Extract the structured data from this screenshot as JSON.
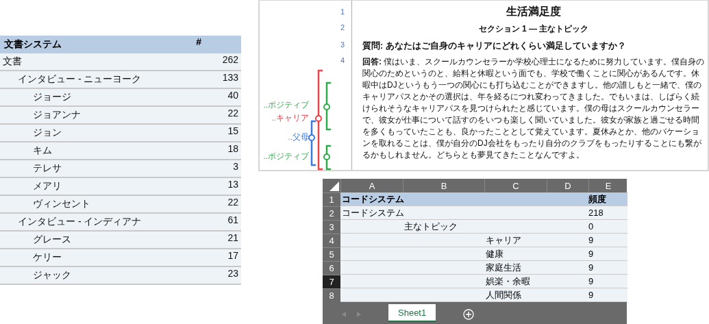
{
  "document_system": {
    "header": {
      "name": "文書システム",
      "count": "#"
    },
    "items": [
      {
        "name": "文書",
        "count": "262",
        "children": [
          {
            "name": "インタビュー - ニューヨーク",
            "count": "133",
            "children": [
              {
                "name": "ジョージ",
                "count": "40"
              },
              {
                "name": "ジョアンナ",
                "count": "22"
              },
              {
                "name": "ジョン",
                "count": "15"
              },
              {
                "name": "キム",
                "count": "18"
              },
              {
                "name": "テレサ",
                "count": "3"
              },
              {
                "name": "メアリ",
                "count": "13"
              },
              {
                "name": "ヴィンセント",
                "count": "22"
              }
            ]
          },
          {
            "name": "インタビュー - インディアナ",
            "count": "61",
            "children": [
              {
                "name": "グレース",
                "count": "21"
              },
              {
                "name": "ケリー",
                "count": "17"
              },
              {
                "name": "ジャック",
                "count": "23"
              }
            ]
          }
        ]
      }
    ]
  },
  "document_viewer": {
    "codes": [
      {
        "label": "..ポジティブ",
        "color": "#2eaa4a"
      },
      {
        "label": "..キャリア",
        "color": "#e8464b"
      },
      {
        "label": "..父母",
        "color": "#3a7ae0"
      },
      {
        "label": "..ポジティブ",
        "color": "#2eaa4a"
      }
    ],
    "paragraphs": [
      {
        "number": "1",
        "kind": "title",
        "text": "生活満足度"
      },
      {
        "number": "2",
        "kind": "subtitle",
        "text": "セクション 1 — 主なトピック"
      },
      {
        "number": "3",
        "kind": "question",
        "text": "質問: あなたはご自身のキャリアにどれくらい満足していますか？"
      },
      {
        "number": "4",
        "kind": "answer",
        "text": "**回答:** 僕はいま、スクールカウンセラーか学校心理士になるために努力しています。僕自身の関心のためというのと、給料と休暇という面でも、学校で働くことに関心があるんです。休暇中はDJというもう一つの関心にも打ち込むことができますし。他の誰しもと一緒で、僕のキャリアパスとかその選択は、年を経るにつれ変わってきました。でもいまは、しばらく続けられそうなキャリアパスを見つけられたと感じています。僕の母はスクールカウンセラーで、彼女が仕事について話すのをいつも楽しく聞いていました。彼女が家族と過ごせる時間を多くもっていたことも、良かったこととして覚えています。夏休みとか、他のバケーションを取れることは、僕が自分のDJ会社をもったり自分のクラブをもったりすることにも繋がるかもしれません。どちらとも夢見てきたことなんですよ。"
      }
    ]
  },
  "spreadsheet": {
    "columns": [
      "A",
      "B",
      "C",
      "D",
      "E"
    ],
    "rows": [
      {
        "number": "1",
        "kind": "header",
        "label": "コードシステム",
        "value": "頻度",
        "selected": false
      },
      {
        "number": "2",
        "kind": "data",
        "label": "コードシステム",
        "value": "218",
        "selected": false,
        "children": [
          {
            "number": "3",
            "kind": "data",
            "label": "主なトピック",
            "value": "0",
            "selected": false,
            "children": [
              {
                "number": "4",
                "kind": "data",
                "label": "キャリア",
                "value": "9",
                "selected": false
              },
              {
                "number": "5",
                "kind": "data",
                "label": "健康",
                "value": "9",
                "selected": false
              },
              {
                "number": "6",
                "kind": "data",
                "label": "家庭生活",
                "value": "9",
                "selected": false
              },
              {
                "number": "7",
                "kind": "data",
                "label": "娯楽・余暇",
                "value": "9",
                "selected": true
              },
              {
                "number": "8",
                "kind": "data",
                "label": "人間関係",
                "value": "9",
                "selected": false
              }
            ]
          }
        ]
      }
    ],
    "sheet_tabs": [
      {
        "label": "Sheet1",
        "selected": true
      }
    ]
  }
}
